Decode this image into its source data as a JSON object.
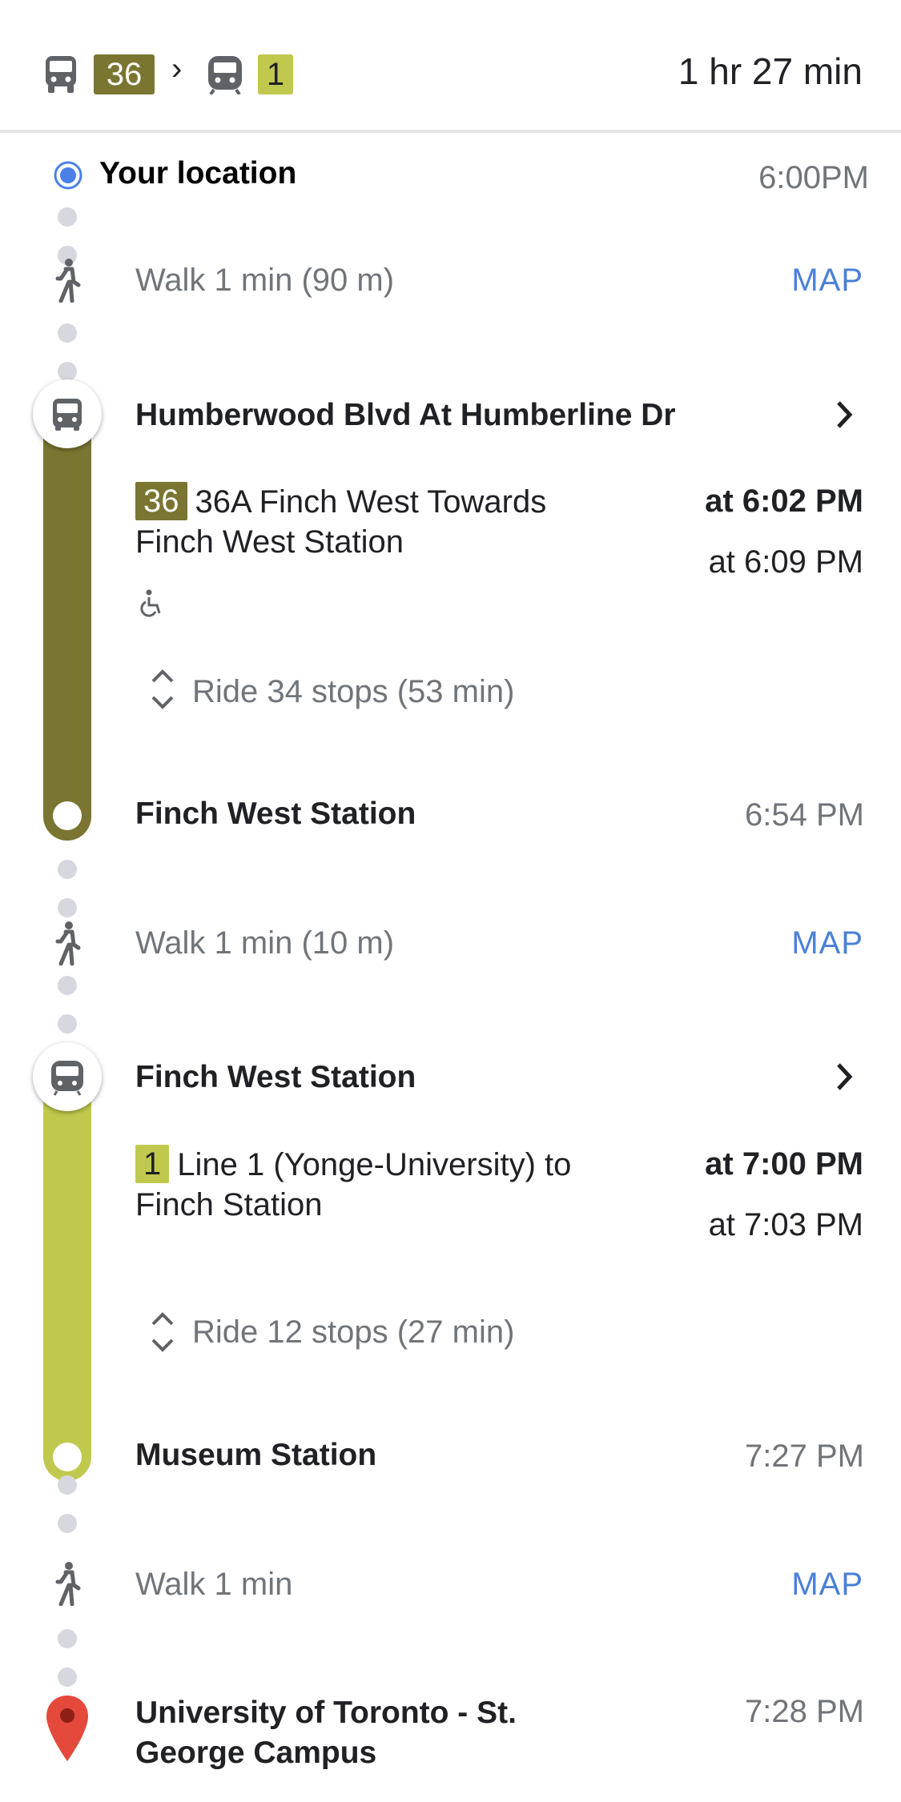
{
  "summary": {
    "route_1_badge": "36",
    "route_2_badge": "1",
    "separator": "›",
    "duration": "1 hr 27 min"
  },
  "colors": {
    "route_36": "#7a7530",
    "line_1": "#c0c94e",
    "origin_blue": "#4a80e8",
    "destination_red": "#e4493c",
    "link_blue": "#4a80d8"
  },
  "origin": {
    "label": "Your location",
    "time": "6:00PM"
  },
  "walk_1": {
    "text": "Walk 1 min (90 m)",
    "map_label": "MAP"
  },
  "leg_1": {
    "stop_name": "Humberwood Blvd At Humberline Dr",
    "badge": "36",
    "description": "36A Finch West Towards Finch West Station",
    "depart_time": "at 6:02 PM",
    "next_time": "at 6:09 PM",
    "ride_info": "Ride 34 stops (53 min)",
    "end_stop": "Finch West Station",
    "end_time": "6:54 PM"
  },
  "walk_2": {
    "text": "Walk 1 min (10 m)",
    "map_label": "MAP"
  },
  "leg_2": {
    "stop_name": "Finch West Station",
    "badge": "1",
    "description": "Line 1 (Yonge-University) to Finch Station",
    "depart_time": "at 7:00 PM",
    "next_time": "at 7:03 PM",
    "ride_info": "Ride 12 stops (27 min)",
    "end_stop": "Museum Station",
    "end_time": "7:27 PM"
  },
  "walk_3": {
    "text": "Walk 1 min",
    "map_label": "MAP"
  },
  "destination": {
    "label": "University of Toronto - St. George Campus",
    "time": "7:28 PM"
  },
  "icons": [
    "bus-icon",
    "subway-icon",
    "walk-icon",
    "wheelchair-icon",
    "chevron-right-icon",
    "expand-icon",
    "location-dot-icon",
    "destination-pin-icon"
  ]
}
